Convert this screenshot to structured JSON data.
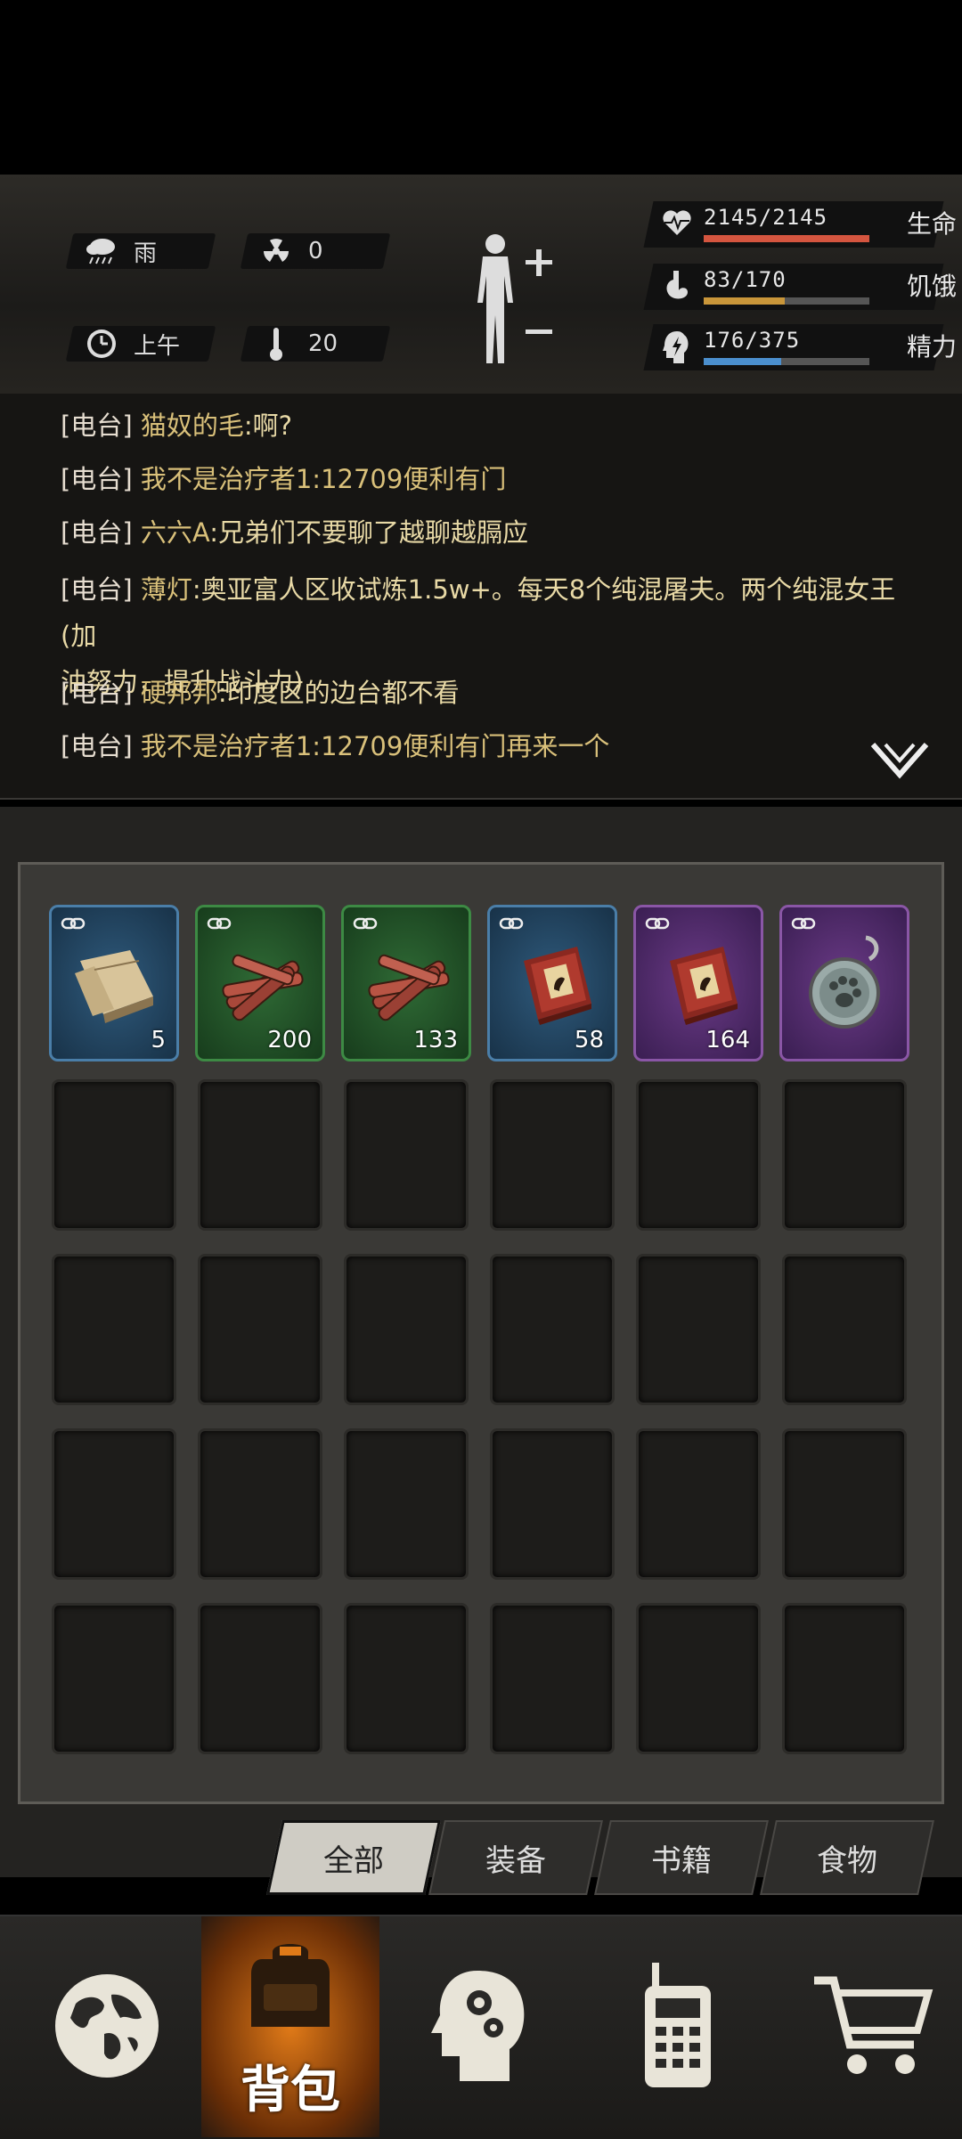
{
  "weather": {
    "condition": "雨",
    "radiation": "0",
    "time": "上午",
    "temperature": "20"
  },
  "stats": [
    {
      "value": "2145/2145",
      "label": "生命",
      "fraction": 1.0,
      "color": "#d4553f",
      "icon": "heartbeat-icon"
    },
    {
      "value": "83/170",
      "label": "饥饿",
      "fraction": 0.49,
      "color": "#c9963a",
      "icon": "stomach-icon"
    },
    {
      "value": "176/375",
      "label": "精力",
      "fraction": 0.47,
      "color": "#4b8fce",
      "icon": "energy-head-icon"
    }
  ],
  "chat": [
    {
      "tag": "[电台]",
      "name": "猫奴的毛",
      "msg": ":啊?"
    },
    {
      "tag": "[电台]",
      "name": "我不是治疗者1:12709便利有门",
      "msg": ""
    },
    {
      "tag": "[电台]",
      "name": "六六A",
      "msg": ":兄弟们不要聊了越聊越膈应"
    },
    {
      "tag": "[电台]",
      "name": "薄灯",
      "msg": ":奥亚富人区收试炼1.5w+。每天8个纯混屠夫。两个纯混女王(加",
      "msg2": "油努力，提升战斗力)"
    },
    {
      "tag": "[电台]",
      "name": "硬邦邦",
      "msg": ":印度区的边台都不看"
    },
    {
      "tag": "[电台]",
      "name": "我不是治疗者1:12709便利有门再来一个",
      "msg": ""
    }
  ],
  "items": [
    {
      "rarity": "blue",
      "icon": "plank-icon",
      "count": "5"
    },
    {
      "rarity": "green",
      "icon": "firewood-icon",
      "count": "200"
    },
    {
      "rarity": "green",
      "icon": "firewood-icon",
      "count": "133"
    },
    {
      "rarity": "blue",
      "icon": "book-icon",
      "count": "58"
    },
    {
      "rarity": "purple",
      "icon": "book-icon",
      "count": "164"
    },
    {
      "rarity": "purple",
      "icon": "dog-tag-icon",
      "count": ""
    }
  ],
  "tabs": {
    "all": "全部",
    "equipment": "装备",
    "books": "书籍",
    "food": "食物"
  },
  "nav": {
    "backpack": "背包"
  }
}
